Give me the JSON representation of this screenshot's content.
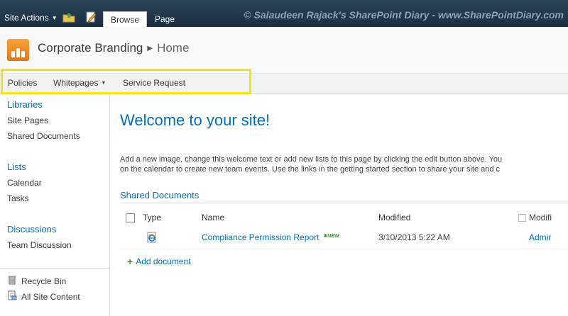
{
  "ribbon": {
    "site_actions": "Site Actions",
    "tabs": [
      {
        "label": "Browse",
        "active": true
      },
      {
        "label": "Page",
        "active": false
      }
    ],
    "watermark": "© Salaudeen Rajack's SharePoint Diary - www.SharePointDiary.com"
  },
  "header": {
    "site_title": "Corporate Branding",
    "current_page": "Home",
    "logo_icon": "sharepoint-people-logo",
    "brand_color": "#f08a1c"
  },
  "top_nav": {
    "items": [
      {
        "label": "Policies"
      },
      {
        "label": "Whitepages",
        "has_dropdown": true
      },
      {
        "label": "Service Request"
      }
    ],
    "highlight_color": "#f5e417"
  },
  "left_nav": {
    "libraries": {
      "heading": "Libraries",
      "items": [
        "Site Pages",
        "Shared Documents"
      ]
    },
    "lists": {
      "heading": "Lists",
      "items": [
        "Calendar",
        "Tasks"
      ]
    },
    "discussions": {
      "heading": "Discussions",
      "items": [
        "Team Discussion"
      ]
    },
    "bottom": [
      {
        "label": "Recycle Bin",
        "icon": "recycle-bin-icon"
      },
      {
        "label": "All Site Content",
        "icon": "site-content-icon"
      }
    ]
  },
  "main": {
    "welcome": "Welcome to your site!",
    "body_line1": "Add a new image, change this welcome text or add new lists to this page by clicking the edit button above. You",
    "body_line2": "on the calendar to create new team events. Use the links in the getting started section to share your site and c",
    "web_part_title": "Shared Documents",
    "columns": [
      "Type",
      "Name",
      "Modified",
      "Modifi"
    ],
    "rows": [
      {
        "type_icon": "ie-document-icon",
        "name": "Compliance Permission Report",
        "new_badge": "NEW",
        "modified": "3/10/2013 5:22 AM",
        "modified_by": "Admir"
      }
    ],
    "add_document": "Add document"
  },
  "colors": {
    "link": "#0072bc",
    "ribbon_bg": "#21374c"
  }
}
